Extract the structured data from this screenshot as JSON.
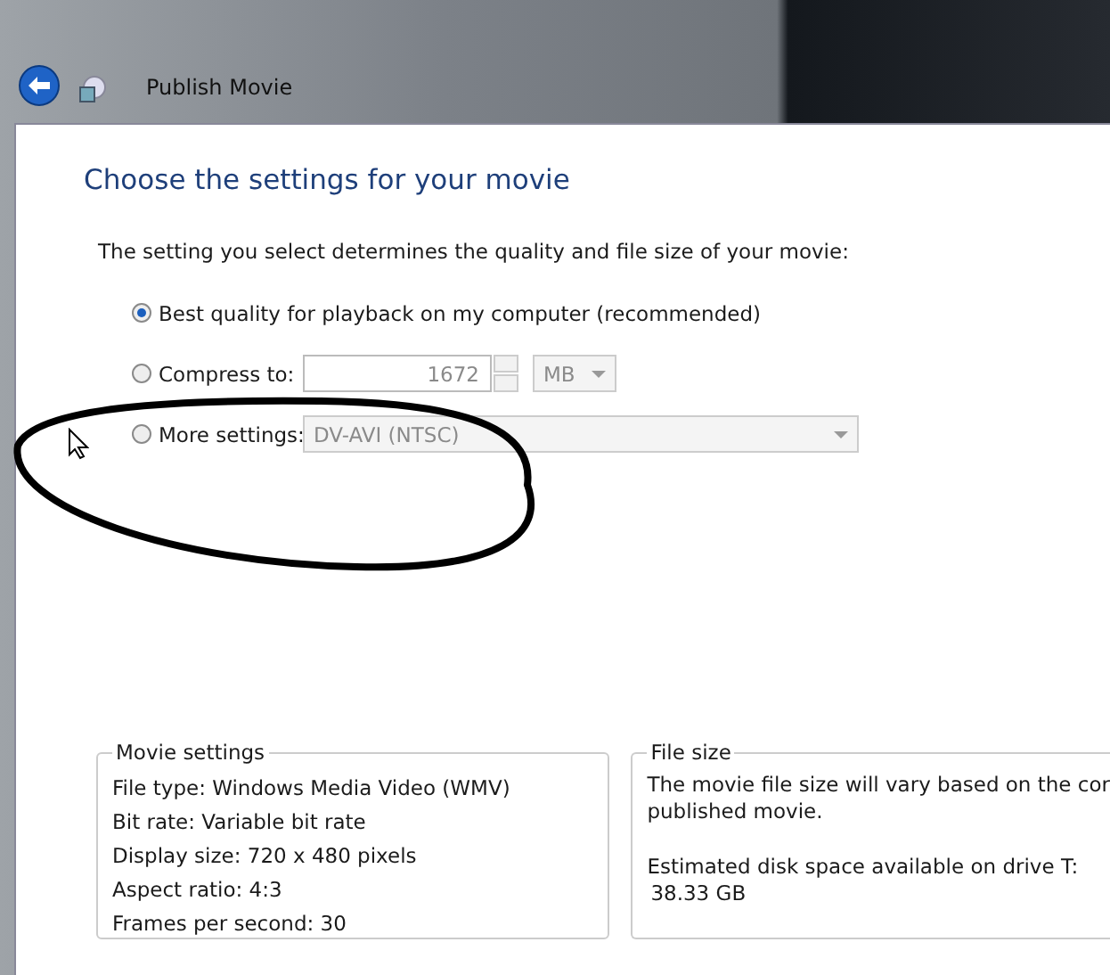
{
  "window": {
    "title": "Publish Movie"
  },
  "heading": "Choose the settings for your movie",
  "description": "The setting you select determines the quality and file size of your movie:",
  "options": [
    {
      "kind": "plain",
      "label": "Best quality for playback on my computer (recommended)",
      "selected": true
    },
    {
      "kind": "size",
      "label": "Compress to:",
      "selected": false,
      "value": "1672",
      "unit": "MB",
      "disabled": true
    },
    {
      "kind": "dropdown",
      "label": "More settings:",
      "selected": false,
      "value": "DV-AVI (NTSC)",
      "disabled": true
    }
  ],
  "movie_settings": {
    "title": "Movie settings",
    "lines": [
      "File type: Windows Media Video (WMV)",
      "Bit rate: Variable bit rate",
      "Display size: 720 x 480 pixels",
      "Aspect ratio: 4:3",
      "Frames per second: 30"
    ]
  },
  "file_size": {
    "title": "File size",
    "lines": [
      "The movie file size will vary based on the cor",
      "published movie."
    ],
    "disk_label": "Estimated disk space available on drive T:",
    "disk_value": "38.33 GB"
  }
}
